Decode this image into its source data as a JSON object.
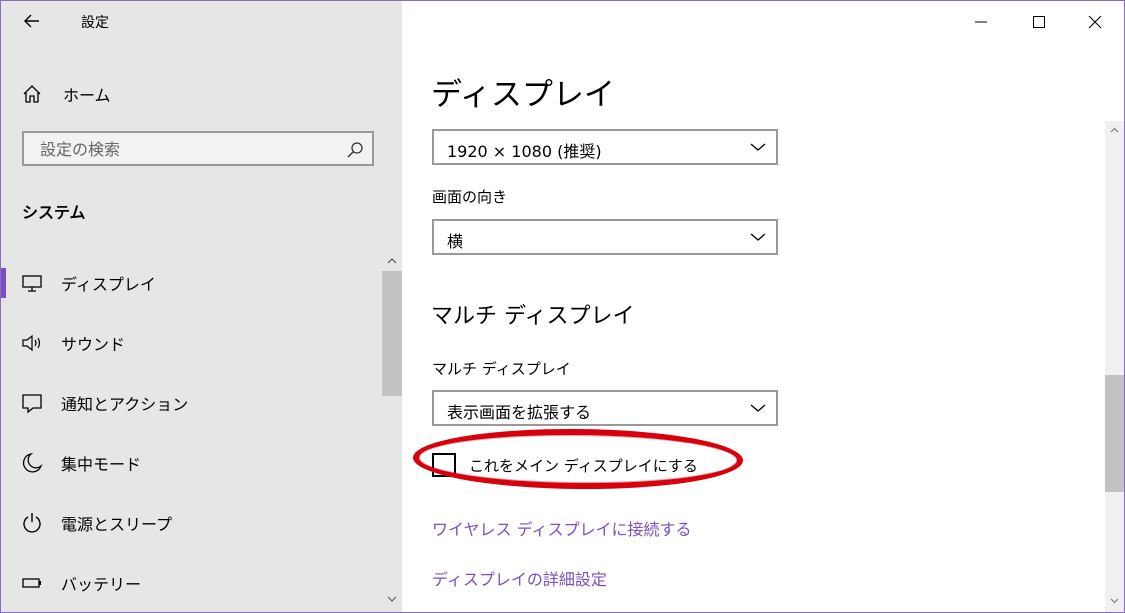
{
  "app": {
    "title": "設定"
  },
  "sidebar": {
    "home_label": "ホーム",
    "search_placeholder": "設定の検索",
    "section_title": "システム",
    "items": [
      {
        "label": "ディスプレイ",
        "icon": "monitor-icon",
        "active": true
      },
      {
        "label": "サウンド",
        "icon": "speaker-icon"
      },
      {
        "label": "通知とアクション",
        "icon": "notification-icon"
      },
      {
        "label": "集中モード",
        "icon": "moon-icon"
      },
      {
        "label": "電源とスリープ",
        "icon": "power-icon"
      },
      {
        "label": "バッテリー",
        "icon": "battery-icon"
      }
    ]
  },
  "main": {
    "title": "ディスプレイ",
    "resolution_value": "1920 × 1080 (推奨)",
    "orientation_label": "画面の向き",
    "orientation_value": "横",
    "multi_display_heading": "マルチ ディスプレイ",
    "multi_display_label": "マルチ ディスプレイ",
    "multi_display_value": "表示画面を拡張する",
    "main_display_checkbox_label": "これをメイン ディスプレイにする",
    "main_display_checked": false,
    "wireless_link": "ワイヤレス ディスプレイに接続する",
    "advanced_link": "ディスプレイの詳細設定"
  },
  "colors": {
    "accent": "#7a4fc2",
    "annotation": "#d8000c",
    "sidebar_bg": "#e6e6e6"
  }
}
